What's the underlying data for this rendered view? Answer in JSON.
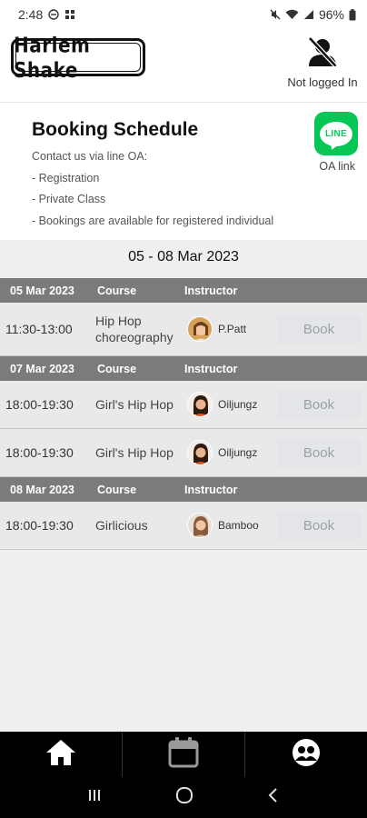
{
  "status_bar": {
    "time": "2:48",
    "battery": "96%"
  },
  "header": {
    "logo_text": "Harlem Shake",
    "user_status": "Not logged In"
  },
  "info": {
    "title": "Booking Schedule",
    "lines": [
      "Contact us via line OA:",
      "- Registration",
      "- Private Class",
      "- Bookings are available for registered individual"
    ],
    "line_badge_text": "LINE",
    "oa_link_label": "OA link"
  },
  "date_range": "05 - 08 Mar 2023",
  "schedule": {
    "course_header": "Course",
    "instructor_header": "Instructor",
    "book_label": "Book",
    "days": [
      {
        "date": "05 Mar 2023",
        "classes": [
          {
            "time": "11:30-13:00",
            "course": "Hip Hop choreography",
            "instructor": "P.Patt"
          }
        ]
      },
      {
        "date": "07 Mar 2023",
        "classes": [
          {
            "time": "18:00-19:30",
            "course": "Girl's Hip Hop",
            "instructor": "Oiljungz"
          },
          {
            "time": "18:00-19:30",
            "course": "Girl's Hip Hop",
            "instructor": "Oiljungz"
          }
        ]
      },
      {
        "date": "08 Mar 2023",
        "classes": [
          {
            "time": "18:00-19:30",
            "course": "Girlicious",
            "instructor": "Bamboo"
          }
        ]
      }
    ]
  },
  "nav_icons": [
    "home-icon",
    "calendar-icon",
    "group-icon"
  ],
  "colors": {
    "line_green": "#06c755",
    "day_header": "#7b7b7b",
    "book_button_bg": "#e3e5e8"
  }
}
